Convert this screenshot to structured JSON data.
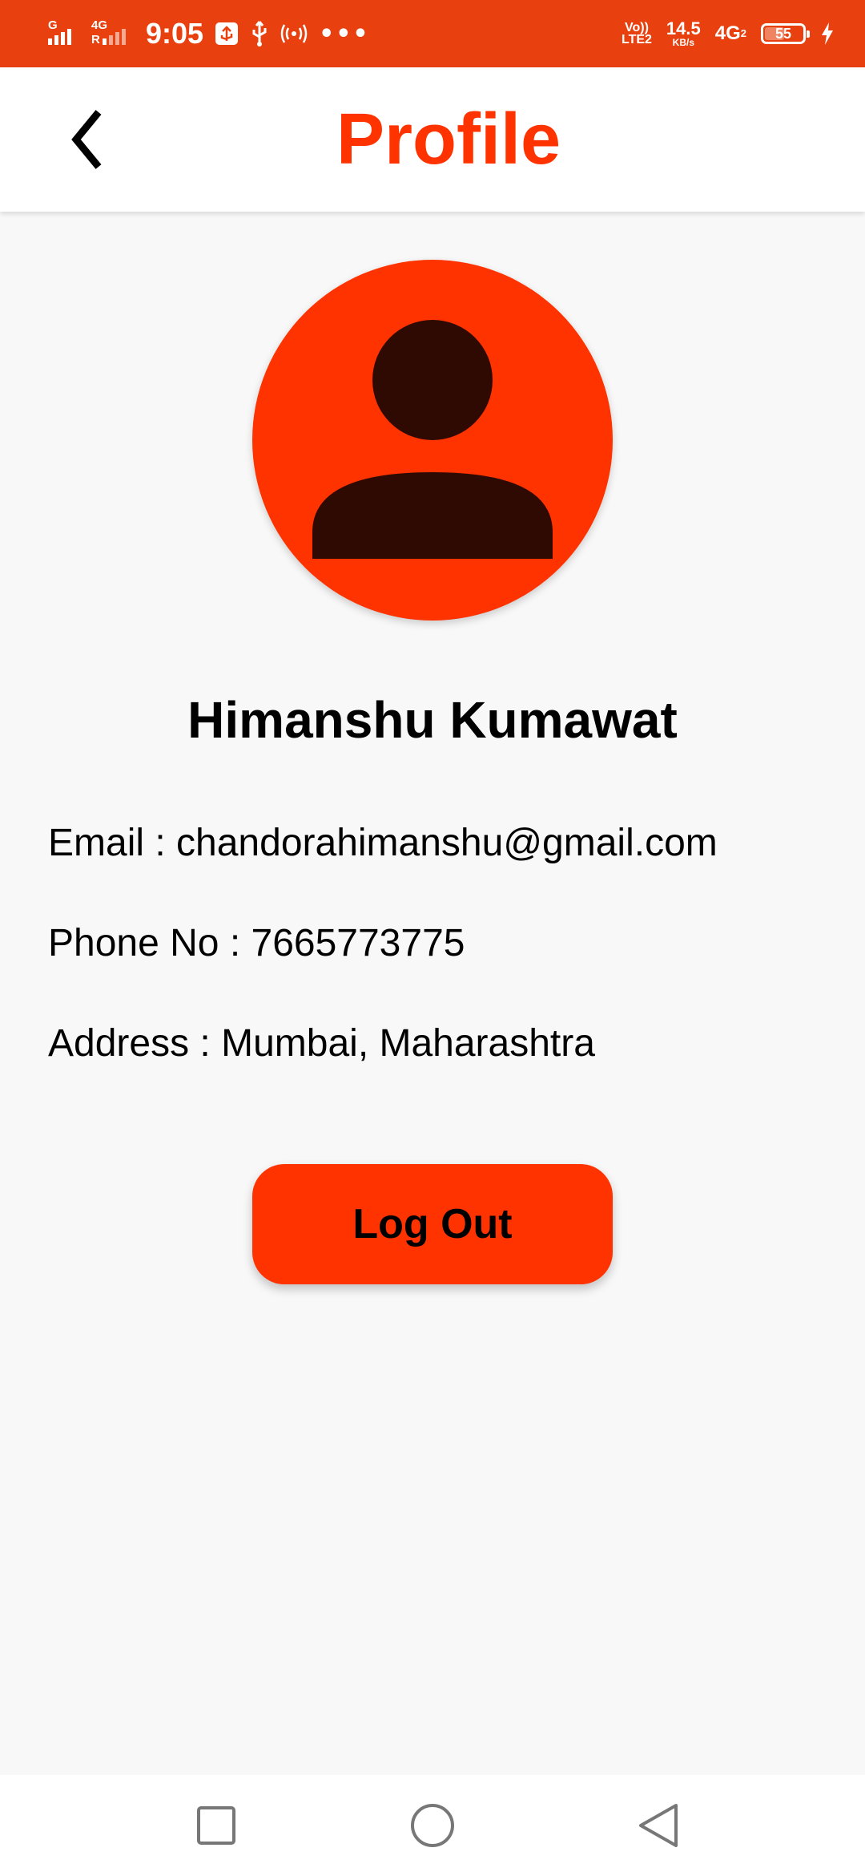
{
  "status_bar": {
    "sim1_label": "G",
    "sim2_top": "4G",
    "sim2_bottom": "R",
    "time": "9:05",
    "more_dots": "•••",
    "volte_top": "Vo))",
    "volte_bottom": "LTE2",
    "speed_value": "14.5",
    "speed_unit": "KB/s",
    "network": "4G",
    "network_sub": "2",
    "battery_level": "55",
    "battery_percent": 55,
    "bar_color": "#e8410f"
  },
  "header": {
    "title": "Profile",
    "back_icon": "chevron-left-icon",
    "title_color": "#ff3300"
  },
  "avatar": {
    "icon": "person-icon",
    "background_color": "#ff3300",
    "figure_color": "#2e0a02"
  },
  "profile": {
    "name": "Himanshu Kumawat",
    "email_line": "Email : chandorahimanshu@gmail.com",
    "phone_line": "Phone No : 7665773775",
    "address_line": "Address : Mumbai, Maharashtra"
  },
  "actions": {
    "logout_label": "Log Out",
    "button_color": "#ff3300"
  },
  "nav_bar": {
    "recents_icon": "square-icon",
    "home_icon": "circle-icon",
    "back_icon": "triangle-back-icon"
  }
}
